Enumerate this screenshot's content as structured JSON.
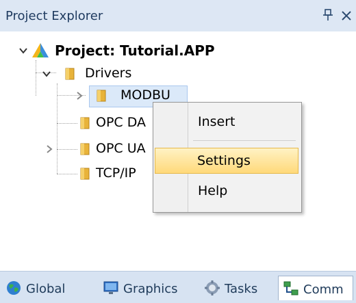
{
  "header": {
    "title": "Project Explorer",
    "pin_icon": "pin-icon",
    "close_icon": "close-icon"
  },
  "tree": {
    "root_label": "Project: Tutorial.APP",
    "drivers_label": "Drivers",
    "modbus_label": "MODBU",
    "opc_da_label": "OPC DA",
    "opc_ua_label": "OPC UA",
    "tcpip_label": "TCP/IP"
  },
  "context_menu": {
    "items": [
      {
        "label": "Insert"
      },
      {
        "label": "Settings",
        "highlighted": true
      },
      {
        "label": "Help"
      }
    ]
  },
  "tabs": [
    {
      "label": "Global",
      "icon": "globe-icon"
    },
    {
      "label": "Graphics",
      "icon": "monitor-icon"
    },
    {
      "label": "Tasks",
      "icon": "gear-icon"
    },
    {
      "label": "Comm",
      "icon": "network-icon",
      "active": true
    }
  ],
  "colors": {
    "header_bg": "#dde7f4",
    "highlight_gradient_top": "#fff2c4",
    "highlight_gradient_bottom": "#ffd97a",
    "tabs_bg": "#d7e3f2",
    "folder": "#e8b33a"
  }
}
